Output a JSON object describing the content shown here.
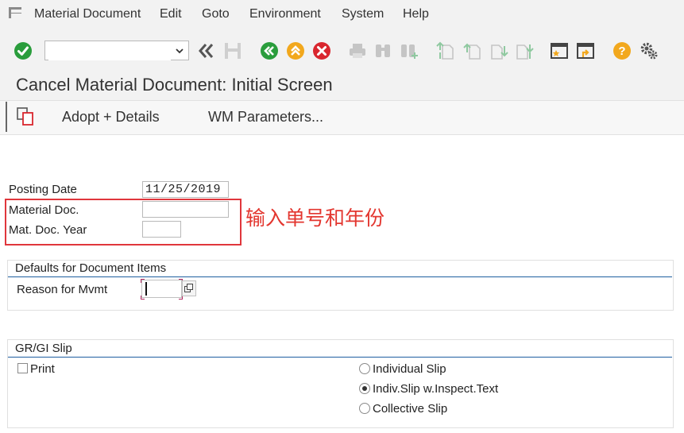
{
  "menubar": {
    "items": [
      "Material Document",
      "Edit",
      "Goto",
      "Environment",
      "System",
      "Help"
    ]
  },
  "toolbar": {
    "command_value": "",
    "icons": [
      "enter-icon",
      "back-double-icon",
      "save-icon",
      "back-icon",
      "exit-icon",
      "cancel-icon",
      "print-icon",
      "find-icon",
      "find-next-icon",
      "first-page-icon",
      "prev-page-icon",
      "next-page-icon",
      "last-page-icon",
      "create-session-icon",
      "shortcut-icon",
      "help-icon",
      "settings-icon"
    ]
  },
  "title": "Cancel Material Document: Initial Screen",
  "app_toolbar": {
    "adopt_details": "Adopt + Details",
    "wm_parameters": "WM Parameters..."
  },
  "form": {
    "posting_date_label": "Posting Date",
    "posting_date_value": "11/25/2019",
    "material_doc_label": "Material Doc.",
    "material_doc_value": "",
    "mat_doc_year_label": "Mat. Doc. Year",
    "mat_doc_year_value": ""
  },
  "annotation": "输入单号和年份",
  "defaults_group": {
    "title": "Defaults for Document Items",
    "reason_label": "Reason for Mvmt",
    "reason_value": ""
  },
  "slip_group": {
    "title": "GR/GI Slip",
    "print_label": "Print",
    "print_checked": false,
    "options": [
      "Individual Slip",
      "Indiv.Slip w.Inspect.Text",
      "Collective Slip"
    ],
    "selected_option": "Indiv.Slip w.Inspect.Text"
  },
  "colors": {
    "accent_green": "#2a9d3c",
    "accent_orange": "#f2a81d",
    "accent_red": "#d9262e",
    "annotation_red": "#e3362f",
    "group_line_blue": "#1f5fa0"
  }
}
